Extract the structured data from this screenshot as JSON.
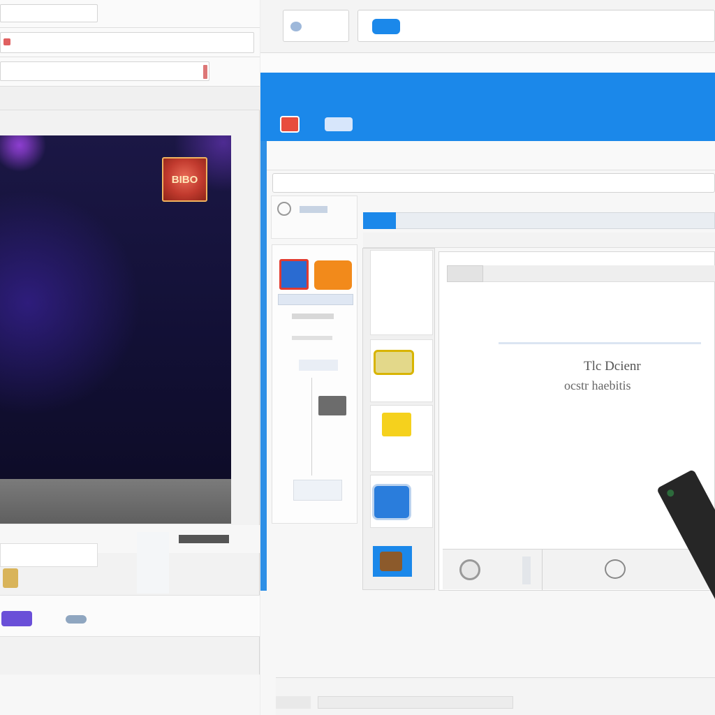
{
  "left_window": {
    "titlebar_label": "",
    "address_text": "",
    "url_line": "",
    "tab_label": "",
    "section_label": "",
    "player_badge_text": "BIBO",
    "player_time": "",
    "channel_name": "",
    "footer_label": ""
  },
  "right_window": {
    "tab_label": "",
    "address_text": "",
    "breadcrumb": "",
    "banner_title": "",
    "banner_subtitle": "",
    "banner_user": "",
    "nav_line": "",
    "search_text": "",
    "toolbar_text": "",
    "panel_caption": "",
    "thumb_header": "",
    "doc_line_1": "Tlc Dcienr",
    "doc_line_2": "ocstr haebitis"
  },
  "colors": {
    "accent_blue": "#1b88ea",
    "badge_red": "#c13a2e",
    "player_dark": "#15122a"
  },
  "icons": {
    "app_icon": "app-icon",
    "close": "close-icon",
    "record": "record-icon"
  }
}
